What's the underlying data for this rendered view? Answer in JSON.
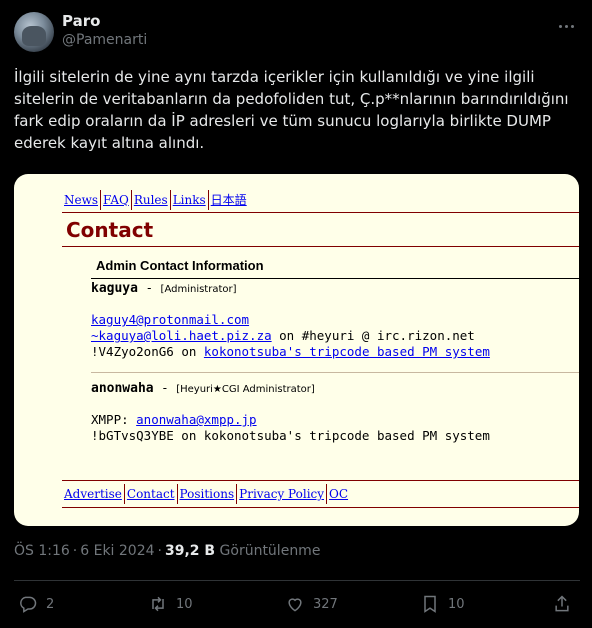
{
  "tweet": {
    "author_name": "Paro",
    "author_handle": "@Pamenarti",
    "text": "İlgili sitelerin de yine aynı tarzda içerikler için kullanıldığı ve yine ilgili sitelerin de veritabanların da pedofoliden tut, Ç.p**nlarının barındırıldığını fark edip oraların da İP adresleri ve tüm sunucu loglarıyla birlikte DUMP ederek kayıt altına alındı.",
    "time": "ÖS 1:16",
    "date": "6 Eki 2024",
    "views": "39,2 B",
    "views_label": "Görüntülenme",
    "replies": "2",
    "retweets": "10",
    "likes": "327",
    "bookmarks": "10"
  },
  "embedded_page": {
    "nav": [
      "News",
      "FAQ",
      "Rules",
      "Links",
      "日本語"
    ],
    "title": "Contact",
    "section_title": "Admin Contact Information",
    "contacts": [
      {
        "name": "kaguya",
        "role": "[Administrator]",
        "email": "kaguy4@protonmail.com",
        "irc_link": "~kaguya@loli.haet.piz.za",
        "irc_suffix": " on #heyuri @ irc.rizon.net",
        "tripcode": "!V4Zyo2onG6",
        "tripcode_mid": " on ",
        "tripcode_link": "kokonotsuba's tripcode based PM system"
      },
      {
        "name": "anonwaha",
        "role": "[Heyuri★CGI Administrator]",
        "xmpp_label": "XMPP: ",
        "xmpp_link": "anonwaha@xmpp.jp",
        "tripcode_line": "!bGTvsQ3YBE on kokonotsuba's tripcode based PM system"
      }
    ],
    "footer": [
      "Advertise",
      "Contact",
      "Positions",
      "Privacy Policy",
      "OC"
    ]
  },
  "colors": {
    "background": "#000000",
    "text": "#e7e9ea",
    "muted": "#71767b",
    "page_bg": "#ffffe9",
    "maroon": "#800000",
    "link": "#0000ee"
  },
  "icons": [
    "more-icon",
    "reply-icon",
    "retweet-icon",
    "like-icon",
    "bookmark-icon",
    "share-icon"
  ]
}
